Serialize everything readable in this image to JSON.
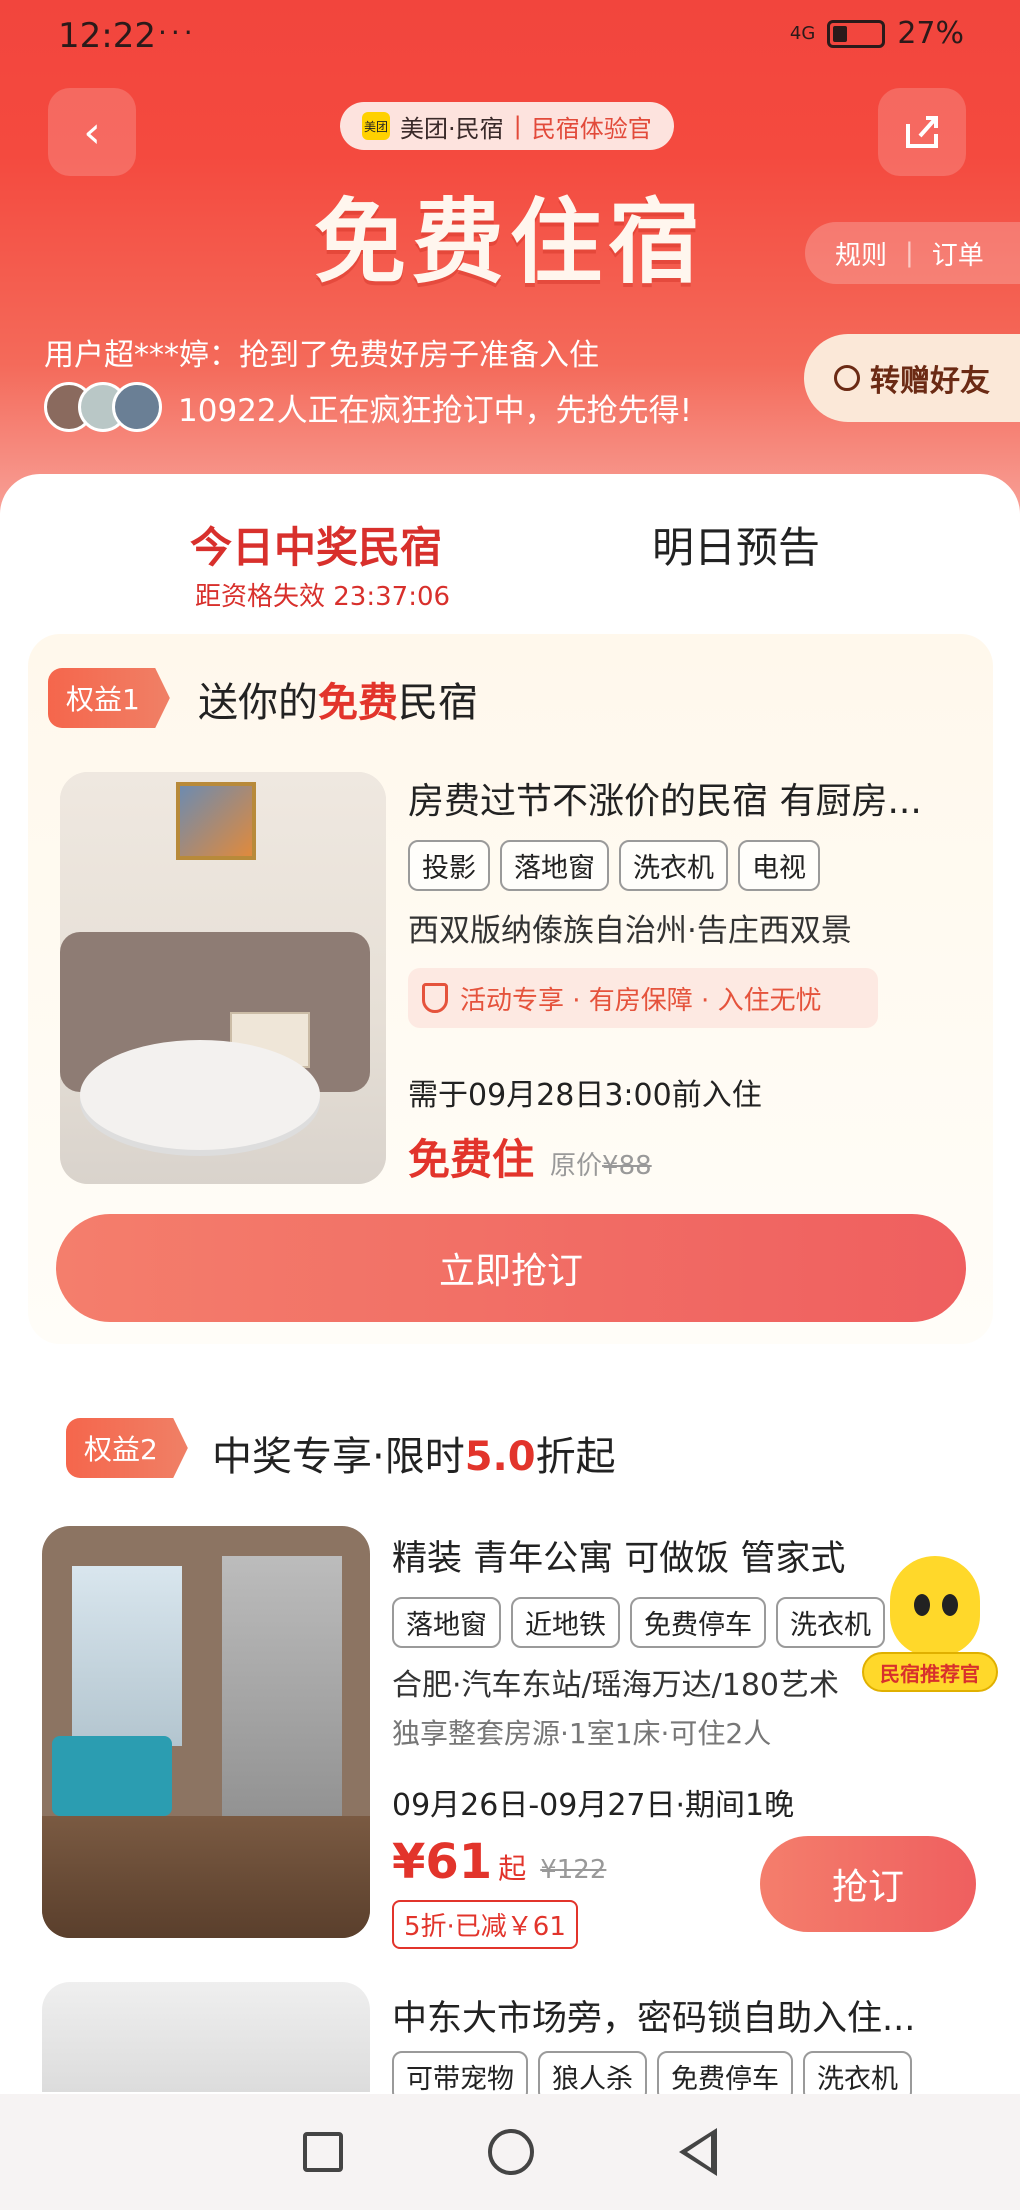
{
  "status_bar": {
    "time": "12:22",
    "notifications": "···",
    "network": "4G",
    "battery": "27%"
  },
  "header": {
    "brand": "美团·民宿",
    "brand_sub": "民宿体验官",
    "brand_logo_text": "美团",
    "title": "免费住宿",
    "rules_label": "规则",
    "orders_label": "订单",
    "winner_text": "用户超***婷：抢到了免费好房子准备入住",
    "rushing_text": "10922人正在疯狂抢订中，先抢先得!",
    "gift_label": "转赠好友"
  },
  "tabs": {
    "today": "今日中奖民宿",
    "tomorrow": "明日预告",
    "countdown": "距资格失效 23:37:06"
  },
  "perk1": {
    "badge": "权益1",
    "heading_pre": "送你的",
    "heading_hl": "免费",
    "heading_post": "民宿",
    "listing": {
      "title": "房费过节不涨价的民宿 有厨房...",
      "tags": [
        "投影",
        "落地窗",
        "洗衣机",
        "电视"
      ],
      "location": "西双版纳傣族自治州·告庄西双景",
      "guarantee": "活动专享 · 有房保障 · 入住无忧",
      "checkin": "需于09月28日3:00前入住",
      "free_label": "免费住",
      "orig_label": "原价",
      "orig_price": "¥88"
    },
    "button": "立即抢订"
  },
  "perk2": {
    "badge": "权益2",
    "heading_pre": "中奖专享·限时",
    "heading_hl": "5.0",
    "heading_post": "折起",
    "listing": {
      "title": "精装 青年公寓  可做饭 管家式",
      "tags": [
        "落地窗",
        "近地铁",
        "免费停车",
        "洗衣机"
      ],
      "location": "合肥·汽车东站/瑶海万达/180艺术",
      "detail": "独享整套房源·1室1床·可住2人",
      "dates": "09月26日-09月27日·期间1晚",
      "price": "¥61",
      "price_suffix": "起",
      "orig_price": "¥122",
      "discount": "5折·已减￥61",
      "button": "抢订"
    },
    "mascot_label": "民宿推荐官"
  },
  "listing3": {
    "title": "中东大市场旁，密码锁自助入住...",
    "tags": [
      "可带宠物",
      "狼人杀",
      "免费停车",
      "洗衣机"
    ]
  },
  "colors": {
    "accent": "#e2342b",
    "hero": "#f2453d",
    "button": "#ef5f5f"
  }
}
